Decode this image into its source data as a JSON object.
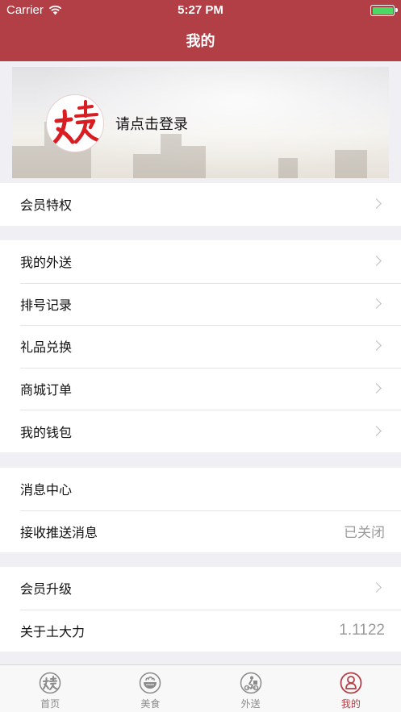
{
  "status_bar": {
    "carrier": "Carrier",
    "time": "5:27 PM"
  },
  "nav": {
    "title": "我的"
  },
  "profile": {
    "login_text": "请点击登录"
  },
  "groups": [
    [
      {
        "label": "会员特权",
        "chevron": true
      }
    ],
    [
      {
        "label": "我的外送",
        "chevron": true
      },
      {
        "label": "排号记录",
        "chevron": true
      },
      {
        "label": "礼品兑换",
        "chevron": true
      },
      {
        "label": "商城订单",
        "chevron": true
      },
      {
        "label": "我的钱包",
        "chevron": true
      }
    ],
    [
      {
        "label": "消息中心",
        "chevron": false
      },
      {
        "label": "接收推送消息",
        "value": "已关闭",
        "chevron": false
      }
    ],
    [
      {
        "label": "会员升级",
        "chevron": true
      },
      {
        "label": "关于土大力",
        "value": "1.1122",
        "chevron": false
      }
    ]
  ],
  "tabs": [
    {
      "label": "首页",
      "icon": "logo-icon",
      "active": false
    },
    {
      "label": "美食",
      "icon": "bowl-icon",
      "active": false
    },
    {
      "label": "外送",
      "icon": "delivery-icon",
      "active": false
    },
    {
      "label": "我的",
      "icon": "person-icon",
      "active": true
    }
  ],
  "colors": {
    "brand": "#b23f46",
    "battery": "#4cd964",
    "muted": "#8a8a8a"
  }
}
